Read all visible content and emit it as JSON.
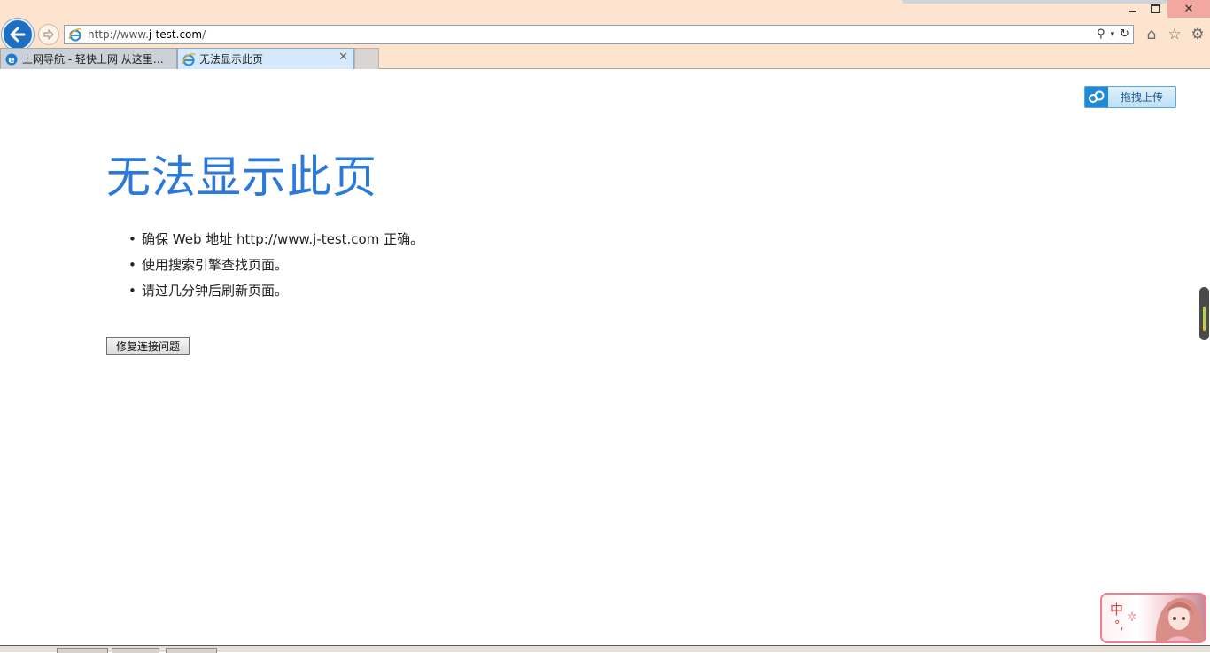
{
  "browser": {
    "url_prefix": "http://www.",
    "url_domain": "j-test.com",
    "url_suffix": "/",
    "window_close_glyph": "✕",
    "tabs": [
      {
        "label": "上网导航 - 轻快上网 从这里开始"
      },
      {
        "label": "无法显示此页",
        "close_glyph": "✕"
      }
    ],
    "icons": [
      "back-arrow-icon",
      "forward-arrow-icon",
      "ie-favicon",
      "search-icon",
      "refresh-icon",
      "home-icon",
      "favorites-star-icon",
      "settings-gear-icon"
    ],
    "accent_color": "#1d6fc4"
  },
  "page": {
    "upload_button_label": "拖拽上传",
    "title": "无法显示此页",
    "tips": [
      "确保 Web 地址 http://www.j-test.com 正确。",
      "使用搜索引擎查找页面。",
      "请过几分钟后刷新页面。"
    ],
    "fix_button_label": "修复连接问题",
    "title_color": "#2c79dc"
  },
  "ime": {
    "mode_char": "中",
    "punct": "°,"
  }
}
